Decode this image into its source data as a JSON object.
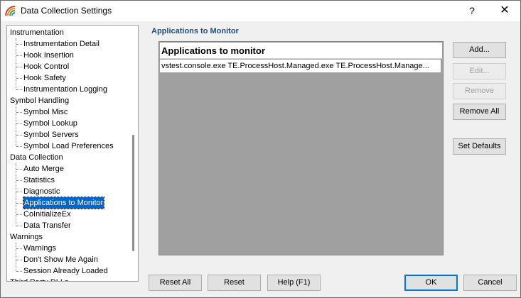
{
  "window": {
    "title": "Data Collection Settings",
    "help_glyph": "?",
    "close_glyph": "✕"
  },
  "tree": {
    "items": [
      {
        "label": "Instrumentation",
        "level": 0
      },
      {
        "label": "Instrumentation Detail",
        "level": 1
      },
      {
        "label": "Hook Insertion",
        "level": 1
      },
      {
        "label": "Hook Control",
        "level": 1
      },
      {
        "label": "Hook Safety",
        "level": 1
      },
      {
        "label": "Instrumentation Logging",
        "level": 1
      },
      {
        "label": "Symbol Handling",
        "level": 0
      },
      {
        "label": "Symbol Misc",
        "level": 1
      },
      {
        "label": "Symbol Lookup",
        "level": 1
      },
      {
        "label": "Symbol Servers",
        "level": 1
      },
      {
        "label": "Symbol Load Preferences",
        "level": 1
      },
      {
        "label": "Data Collection",
        "level": 0
      },
      {
        "label": "Auto Merge",
        "level": 1
      },
      {
        "label": "Statistics",
        "level": 1
      },
      {
        "label": "Diagnostic",
        "level": 1
      },
      {
        "label": "Applications to Monitor",
        "level": 1,
        "selected": true
      },
      {
        "label": "CoInitializeEx",
        "level": 1
      },
      {
        "label": "Data Transfer",
        "level": 1
      },
      {
        "label": "Warnings",
        "level": 0
      },
      {
        "label": "Warnings",
        "level": 1
      },
      {
        "label": "Don't Show Me Again",
        "level": 1
      },
      {
        "label": "Session Already Loaded",
        "level": 1
      },
      {
        "label": "Third Party DLLs",
        "level": 0
      }
    ]
  },
  "panel": {
    "section_title": "Applications to Monitor",
    "list_header": "Applications to monitor",
    "rows": [
      "vstest.console.exe TE.ProcessHost.Managed.exe TE.ProcessHost.Manage..."
    ]
  },
  "side_buttons": {
    "add": "Add...",
    "edit": "Edit...",
    "remove": "Remove",
    "remove_all": "Remove All",
    "set_defaults": "Set Defaults"
  },
  "bottom_buttons": {
    "reset_all": "Reset All",
    "reset": "Reset",
    "help": "Help (F1)",
    "ok": "OK",
    "cancel": "Cancel"
  }
}
